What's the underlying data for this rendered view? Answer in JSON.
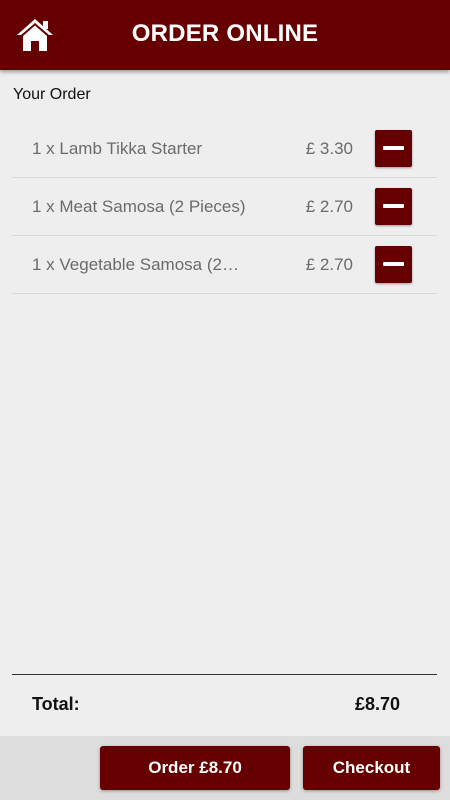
{
  "header": {
    "title": "ORDER ONLINE",
    "home_icon": "home-icon",
    "background_color": "#660000"
  },
  "order": {
    "section_label": "Your Order",
    "items": [
      {
        "label": "1 x Lamb Tikka Starter",
        "price": "£ 3.30",
        "remove_icon": "minus-icon"
      },
      {
        "label": "1 x Meat Samosa (2 Pieces)",
        "price": "£ 2.70",
        "remove_icon": "minus-icon"
      },
      {
        "label": "1 x Vegetable Samosa (2…",
        "price": "£ 2.70",
        "remove_icon": "minus-icon"
      }
    ]
  },
  "summary": {
    "total_label": "Total:",
    "total_value": "£8.70"
  },
  "actions": {
    "order_button": "Order £8.70",
    "checkout_button": "Checkout",
    "accent_color": "#660000"
  }
}
